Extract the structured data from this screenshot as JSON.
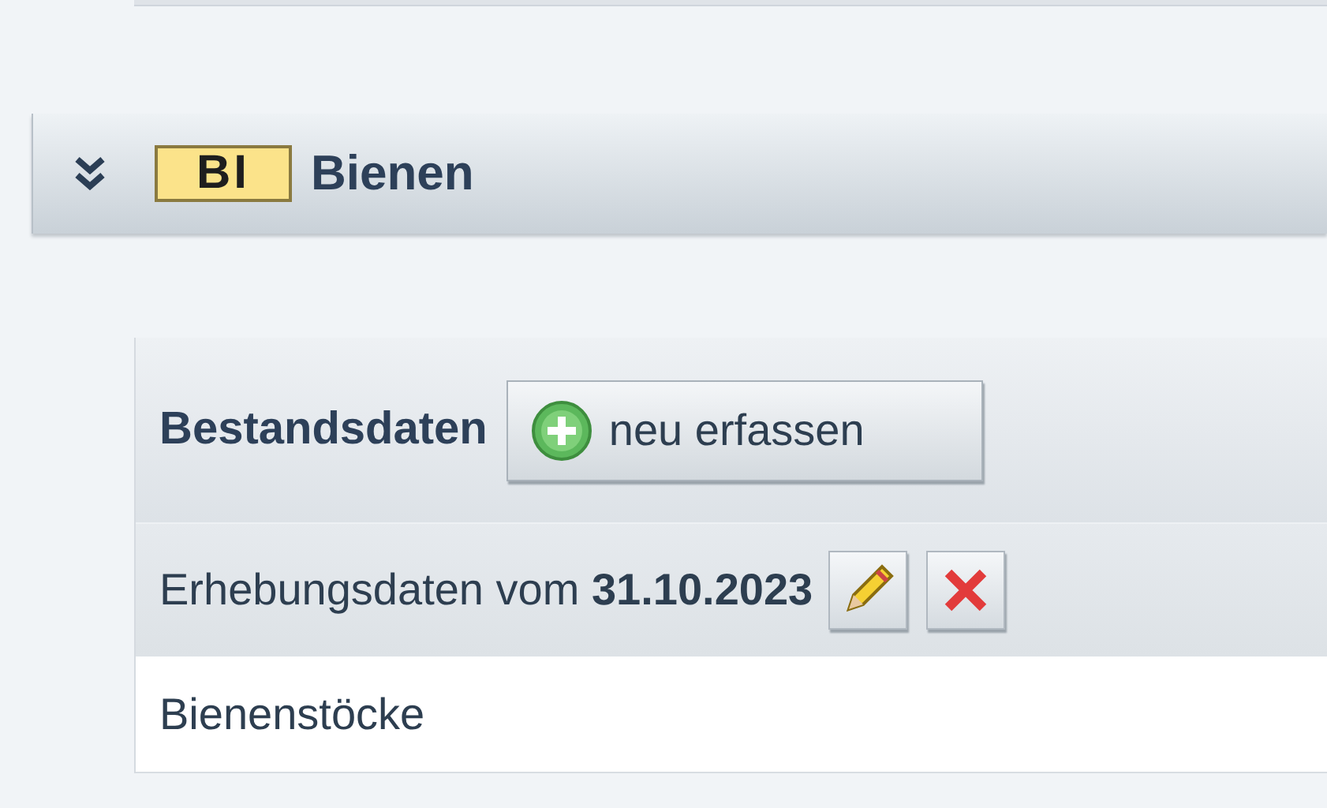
{
  "section": {
    "expanded": true,
    "badge": "BI",
    "title": "Bienen"
  },
  "card": {
    "title": "Bestandsdaten",
    "add_button": "neu erfassen",
    "record": {
      "label": "Erhebungsdaten vom **31.10.2023**"
    },
    "rows": [
      "Bienenstöcke"
    ]
  }
}
